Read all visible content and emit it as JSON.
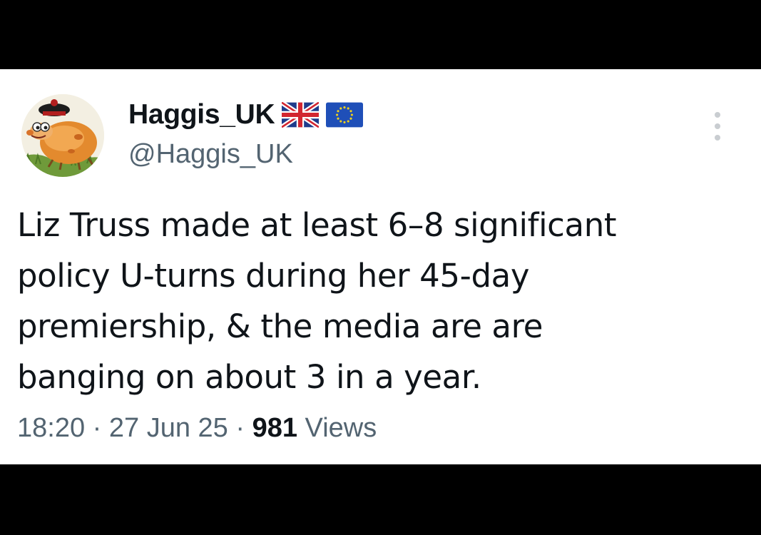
{
  "tweet": {
    "author": {
      "display_name": "Haggis_UK",
      "handle": "@Haggis_UK",
      "badges": [
        "uk-flag-icon",
        "eu-flag-icon"
      ],
      "avatar": "cartoon-haggis-avatar"
    },
    "text_lines": [
      "Liz Truss made at least 6–8 significant",
      "policy U-turns during her 45-day",
      "premiership, & the media are are",
      "banging on about 3 in a year."
    ],
    "time": "18:20",
    "separator": "·",
    "date": "27 Jun 25",
    "views_count": "981",
    "views_label": "Views",
    "more_icon": "more-vertical-icon"
  },
  "colors": {
    "background": "#ffffff",
    "frame": "#000000",
    "primary_text": "#0f1419",
    "secondary_text": "#536471"
  }
}
